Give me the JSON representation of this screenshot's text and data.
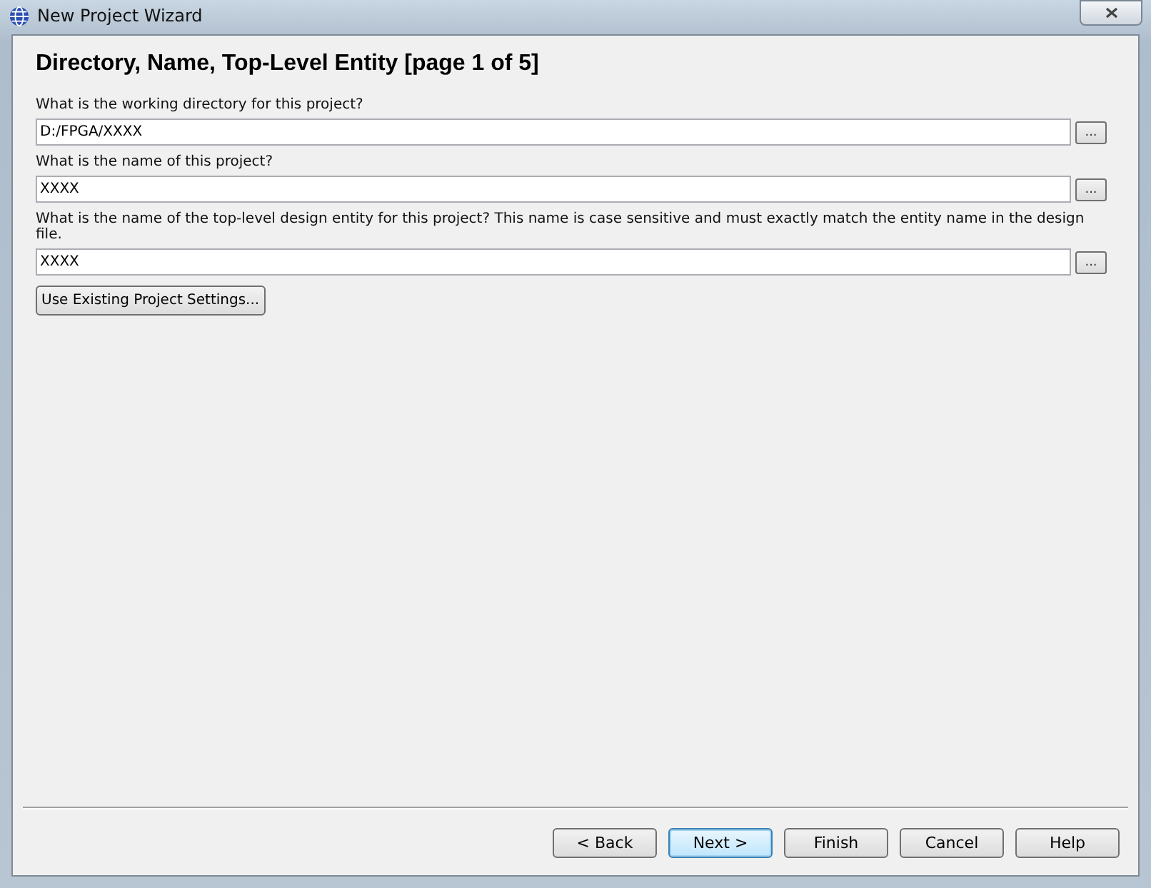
{
  "window": {
    "title": "New Project Wizard"
  },
  "page_title": "Directory, Name, Top-Level Entity [page 1 of 5]",
  "fields": [
    {
      "label": "What is the working directory for this project?",
      "value": "D:/FPGA/XXXX",
      "browse": "..."
    },
    {
      "label": "What is the name of this project?",
      "value": "XXXX",
      "browse": "..."
    },
    {
      "label": "What is the name of the top-level design entity for this project? This name is case sensitive and must exactly match the entity name in the design file.",
      "value": "XXXX",
      "browse": "..."
    }
  ],
  "settings_button": "Use Existing Project Settings...",
  "buttons": [
    {
      "label": "< Back",
      "default": false
    },
    {
      "label": "Next >",
      "default": true
    },
    {
      "label": "Finish",
      "default": false
    },
    {
      "label": "Cancel",
      "default": false
    },
    {
      "label": "Help",
      "default": false
    }
  ]
}
